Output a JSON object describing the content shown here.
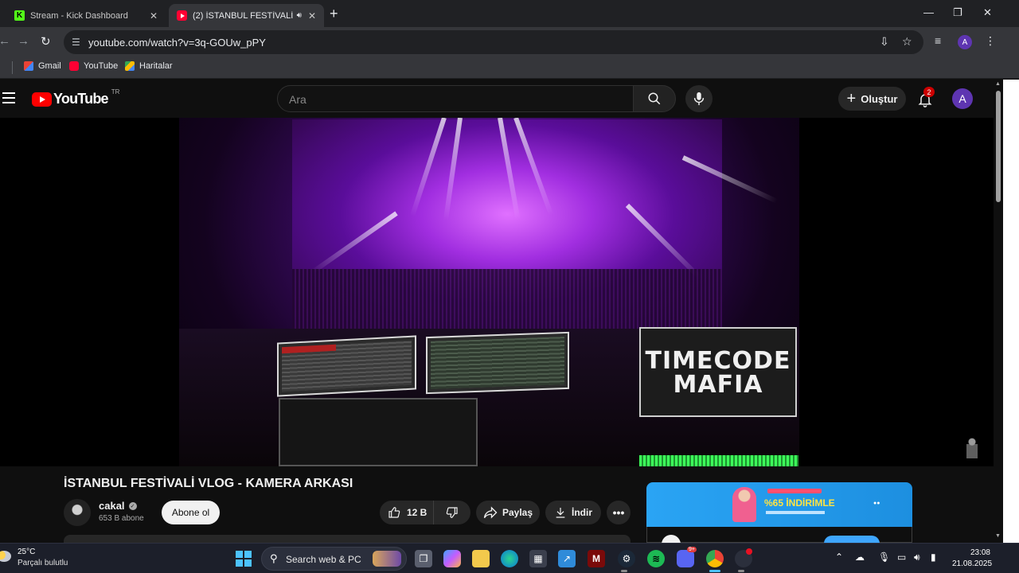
{
  "browser": {
    "tabs": [
      {
        "title": "Stream - Kick Dashboard",
        "favicon": "kick-icon",
        "active": false
      },
      {
        "title": "(2) İSTANBUL FESTİVALİ VLOG - KAMERA ARKASI - YouTube",
        "favicon": "youtube-icon",
        "active": true,
        "audio": true
      }
    ],
    "url": "youtube.com/watch?v=3q-GOUw_pPY",
    "profile_initial": "A",
    "bookmarks": [
      {
        "label": "Gmail",
        "icon": "gmail-icon"
      },
      {
        "label": "YouTube",
        "icon": "youtube-icon"
      },
      {
        "label": "Haritalar",
        "icon": "maps-icon"
      }
    ]
  },
  "youtube": {
    "logo_text": "YouTube",
    "country_code": "TR",
    "search_placeholder": "Ara",
    "create_label": "Oluştur",
    "notification_count": "2",
    "avatar_initial": "A",
    "video": {
      "overlay_text": "TIMECODE MAFIA",
      "title": "İSTANBUL FESTİVALİ VLOG - KAMERA ARKASI",
      "channel": "cakal",
      "subscribers": "653 B abone",
      "subscribe_label": "Abone ol",
      "likes": "12 B",
      "share_label": "Paylaş",
      "download_label": "İndir"
    },
    "ad": {
      "headline": "%65 İNDİRİMLE"
    }
  },
  "taskbar": {
    "temperature": "25°C",
    "weather": "Parçalı bulutlu",
    "search_placeholder": "Search web & PC",
    "time": "23:08",
    "date": "21.08.2025",
    "discord_badge": "9+"
  },
  "colors": {
    "youtube_red": "#ff0000",
    "subscribe_bg": "#f1f1f1",
    "windows_accent": "#4cc2ff",
    "notification_badge": "#cc0000"
  }
}
